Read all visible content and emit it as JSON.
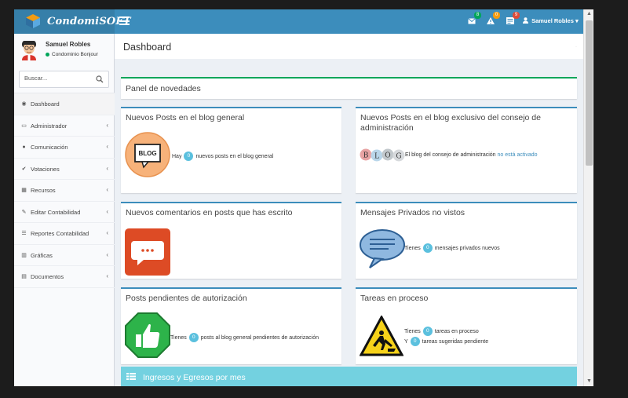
{
  "app": {
    "brand": "CondomiSOFT",
    "accent": "#3c8dbc",
    "brand_bg": "#367fa9"
  },
  "header": {
    "notifications": [
      {
        "icon": "envelope-icon",
        "count": "8",
        "color": "#00a65a"
      },
      {
        "icon": "warning-icon",
        "count": "0",
        "color": "#f39c12"
      },
      {
        "icon": "tasks-icon",
        "count": "9",
        "color": "#dd4b39"
      }
    ],
    "user_name": "Samuel Robles",
    "user_caret": "▾"
  },
  "sidebar": {
    "user_name": "Samuel Robles",
    "user_status": "Condominio Bonjour",
    "search_placeholder": "Buscar...",
    "items": [
      {
        "label": "Dashboard",
        "icon": "dashboard-icon",
        "glyph": "◉",
        "chevron": ""
      },
      {
        "label": "Administrador",
        "icon": "laptop-icon",
        "glyph": "▭",
        "chevron": "‹"
      },
      {
        "label": "Comunicación",
        "icon": "comments-icon",
        "glyph": "●",
        "chevron": "‹"
      },
      {
        "label": "Votaciones",
        "icon": "check-icon",
        "glyph": "✔",
        "chevron": "‹"
      },
      {
        "label": "Recursos",
        "icon": "calendar-icon",
        "glyph": "▦",
        "chevron": "‹"
      },
      {
        "label": "Editar Contabilidad",
        "icon": "edit-icon",
        "glyph": "✎",
        "chevron": "‹"
      },
      {
        "label": "Reportes Contabilidad",
        "icon": "list-icon",
        "glyph": "☰",
        "chevron": "‹"
      },
      {
        "label": "Gráficas",
        "icon": "chart-icon",
        "glyph": "▥",
        "chevron": "‹"
      },
      {
        "label": "Documentos",
        "icon": "folder-icon",
        "glyph": "▤",
        "chevron": "‹"
      }
    ]
  },
  "content": {
    "page_title": "Dashboard",
    "header_dot": "·",
    "panel_title": "Panel de novedades",
    "boxes": {
      "blog_general": {
        "title": "Nuevos Posts en el blog general",
        "icon_label": "BLOG",
        "text_before": "Hay",
        "count": "0",
        "text_after": "nuevos posts en el blog general"
      },
      "blog_consejo": {
        "title": "Nuevos Posts en el blog exclusivo del consejo de administración",
        "text_before": "El blog del consejo de administración",
        "link_text": "no está activado",
        "letters": [
          "B",
          "L",
          "O",
          "G"
        ]
      },
      "comentarios": {
        "title": "Nuevos comentarios en posts que has escrito"
      },
      "mensajes": {
        "title": "Mensajes Privados no vistos",
        "text_before": "Tienes",
        "count": "0",
        "text_after": "mensajes privados nuevos"
      },
      "pendientes": {
        "title": "Posts pendientes de autorización",
        "text_before": "Tienes",
        "count": "0",
        "text_after": "posts al blog general pendientes de autorización"
      },
      "tareas": {
        "title": "Tareas en proceso",
        "line1_before": "Tienes",
        "line1_count": "0",
        "line1_after": "tareas en proceso",
        "line2_before": "Y",
        "line2_count": "0",
        "line2_after": "tareas sugeridas pendiente"
      }
    },
    "bottom_bar_title": "Ingresos y Egresos por mes"
  }
}
